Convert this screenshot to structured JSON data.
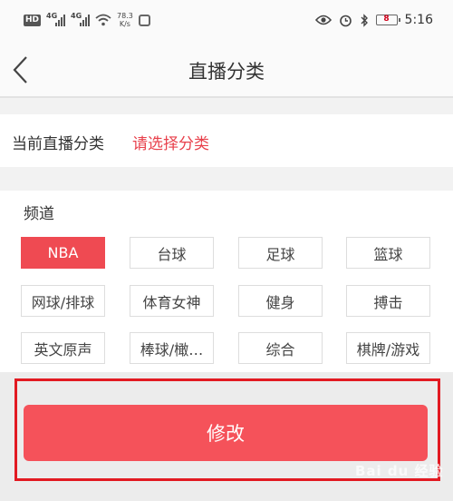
{
  "status_bar": {
    "hd": "HD",
    "net1": "4G",
    "net2": "4G",
    "speed_value": "78.3",
    "speed_unit": "K/s",
    "battery": "8",
    "time": "5:16"
  },
  "nav": {
    "title": "直播分类"
  },
  "current": {
    "label": "当前直播分类",
    "value": "请选择分类"
  },
  "channels": {
    "title": "频道",
    "selected_index": 0,
    "items": [
      {
        "label": "NBA"
      },
      {
        "label": "台球"
      },
      {
        "label": "足球"
      },
      {
        "label": "篮球"
      },
      {
        "label": "网球/排球"
      },
      {
        "label": "体育女神"
      },
      {
        "label": "健身"
      },
      {
        "label": "搏击"
      },
      {
        "label": "英文原声"
      },
      {
        "label": "棒球/橄…"
      },
      {
        "label": "综合"
      },
      {
        "label": "棋牌/游戏"
      }
    ]
  },
  "action": {
    "modify_label": "修改"
  },
  "watermark": "Bai du 经验",
  "colors": {
    "accent": "#ef4a52",
    "button": "#f5525a",
    "highlight": "#e21a22"
  }
}
